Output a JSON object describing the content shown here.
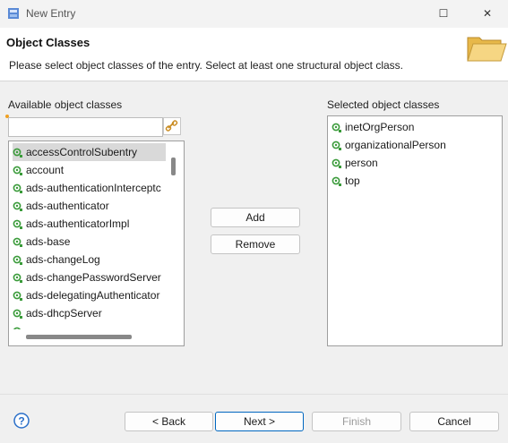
{
  "window": {
    "title": "New Entry",
    "maximize_glyph": "☐",
    "close_glyph": "✕"
  },
  "header": {
    "title": "Object Classes",
    "description": "Please select object classes of the entry. Select at least one structural object class.",
    "icon": "folder-icon"
  },
  "available": {
    "label": "Available object classes",
    "search_value": "",
    "items": [
      "accessControlSubentry",
      "account",
      "ads-authenticationInterceptc",
      "ads-authenticator",
      "ads-authenticatorImpl",
      "ads-base",
      "ads-changeLog",
      "ads-changePasswordServer",
      "ads-delegatingAuthenticator",
      "ads-dhcpServer"
    ],
    "selected_index": 0
  },
  "middle": {
    "add_label": "Add",
    "remove_label": "Remove"
  },
  "selected": {
    "label": "Selected object classes",
    "items": [
      "inetOrgPerson",
      "organizationalPerson",
      "person",
      "top"
    ]
  },
  "footer": {
    "back_label": "< Back",
    "next_label": "Next >",
    "finish_label": "Finish",
    "cancel_label": "Cancel",
    "help_glyph": "?"
  },
  "colors": {
    "accent": "#0067c0",
    "oc_icon": "#3a9b3a"
  }
}
